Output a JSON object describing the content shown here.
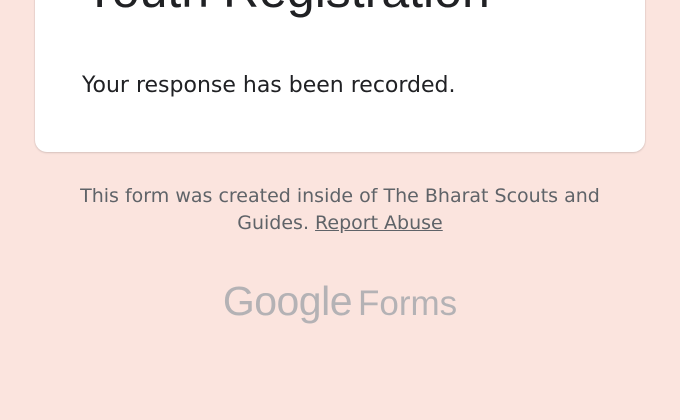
{
  "form": {
    "title": "Youth Registration",
    "confirmation": "Your response has been recorded."
  },
  "footer": {
    "note_line1": "This form was created inside of The Bharat Scouts and",
    "note_line2_prefix": "Guides.",
    "report_abuse": "Report Abuse"
  },
  "branding": {
    "google": "Google",
    "product": "Forms"
  },
  "colors": {
    "page_background": "#fbe4de",
    "card_background": "#ffffff",
    "text_primary": "#202124",
    "text_secondary": "#5f6368",
    "logo_gray": "#9aa0a6"
  }
}
